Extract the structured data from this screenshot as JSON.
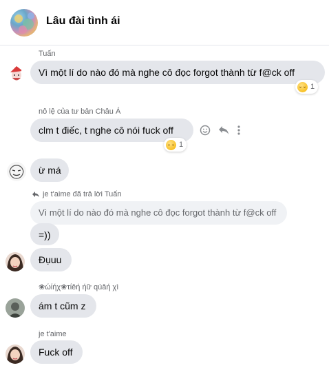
{
  "conversation": {
    "title": "Lâu đài tình ái"
  },
  "messages": [
    {
      "sender": "Tuấn",
      "text": "Vì một lí do nào đó mà nghe cô đọc forgot thành từ f@ck off",
      "reaction_count": "1"
    },
    {
      "sender": "nô lệ của tư bản Châu Á",
      "text": "clm t điếc, t nghe cô nói fuck off",
      "reaction_count": "1"
    },
    {
      "text": "ừ má"
    },
    {
      "reply_note": "je t'aime đã trả lời Tuấn",
      "quoted": "Vì một lí do nào đó mà nghe cô đọc forgot thành từ f@ck off",
      "text": "=))"
    },
    {
      "text": "Đụuu"
    },
    {
      "sender": "❀ώίήχ❀τίêή ήữ qúâή χì",
      "text": "ám t cũm z"
    },
    {
      "sender": "je t'aime",
      "text": "Fuck off"
    }
  ],
  "colors": {
    "bubble": "#e4e6eb",
    "quoted_bubble": "#f0f2f5",
    "secondary_text": "#65676b"
  }
}
